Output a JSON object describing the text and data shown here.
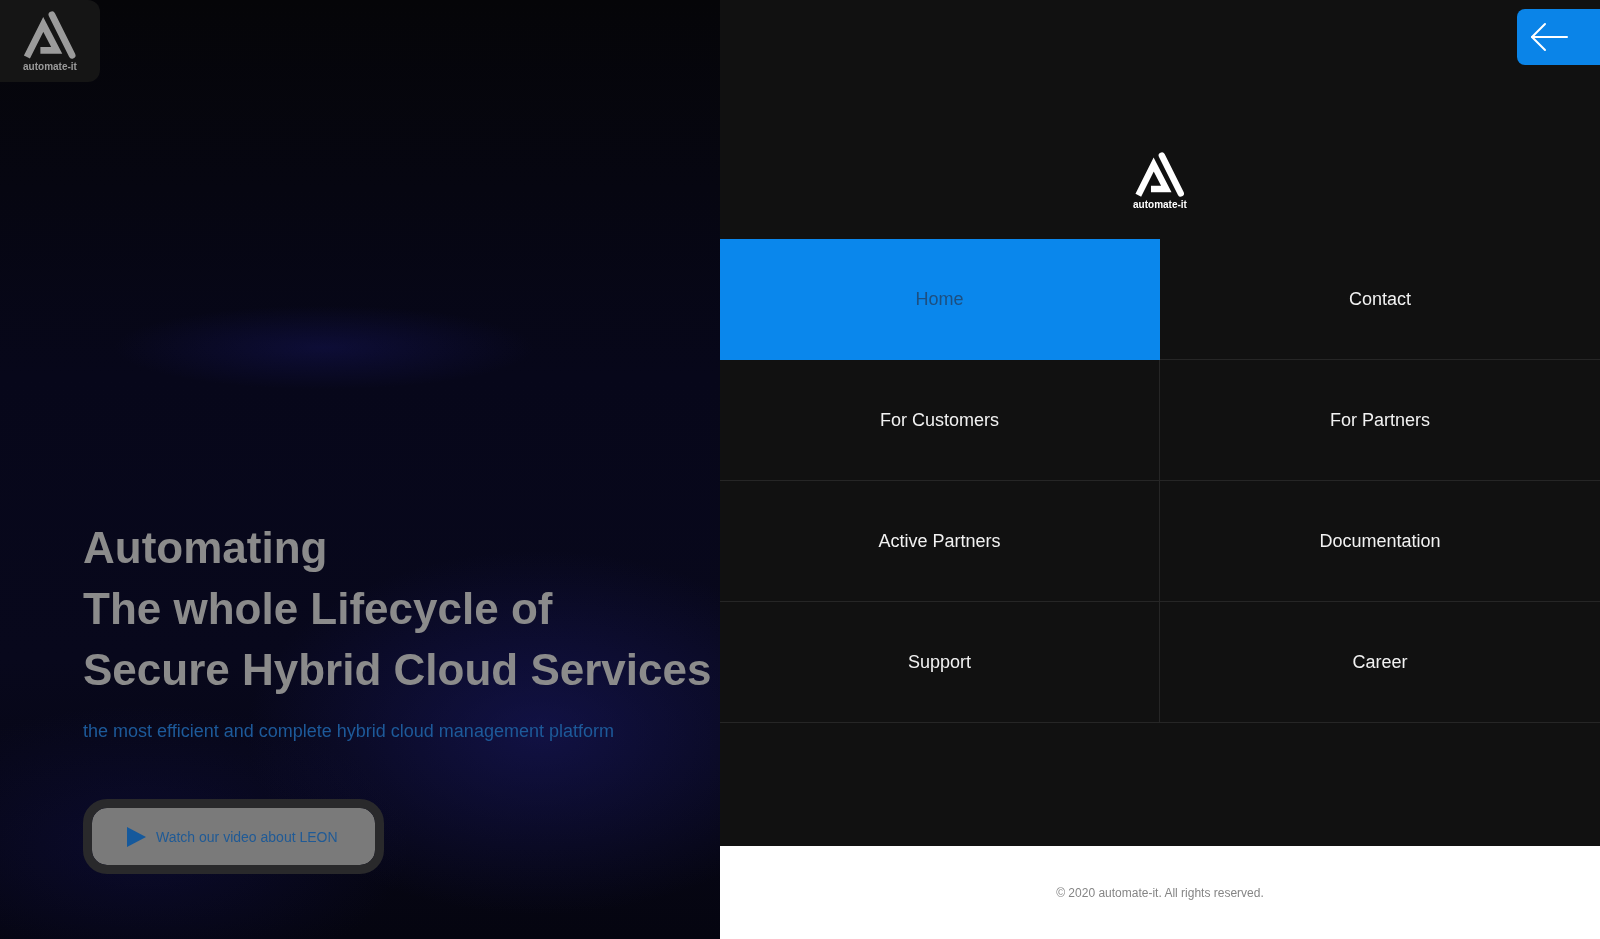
{
  "top_bar": {
    "logo_text": "automate-it"
  },
  "hero": {
    "title": "Automating\nThe whole Lifecycle of\nSecure Hybrid Cloud Services",
    "subtitle": "the most efficient and complete hybrid cloud management platform",
    "video_button": "Watch our video about LEON"
  },
  "menu_panel": {
    "logo_text": "automate-it",
    "items": [
      {
        "label": "Home",
        "selected": true
      },
      {
        "label": "Contact",
        "selected": false
      },
      {
        "label": "For Customers",
        "selected": false
      },
      {
        "label": "For Partners",
        "selected": false
      },
      {
        "label": "Active Partners",
        "selected": false
      },
      {
        "label": "Documentation",
        "selected": false
      },
      {
        "label": "Support",
        "selected": false
      },
      {
        "label": "Career",
        "selected": false
      }
    ]
  },
  "footer": {
    "copyright": "© 2020 automate-it. All rights reserved."
  }
}
